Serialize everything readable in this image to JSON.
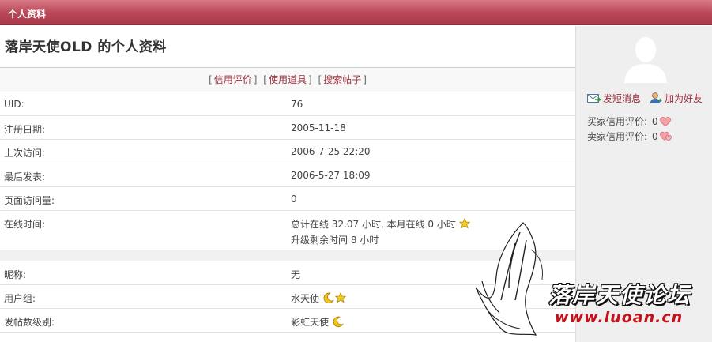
{
  "header": {
    "title": "个人资料"
  },
  "page": {
    "title": "落岸天使OLD 的个人资料"
  },
  "actions": {
    "credit": "信用评价",
    "props": "使用道具",
    "search": "搜索帖子"
  },
  "profile": {
    "uid_label": "UID:",
    "uid_value": "76",
    "reg_label": "注册日期:",
    "reg_value": "2005-11-18",
    "visit_label": "上次访问:",
    "visit_value": "2006-7-25 22:20",
    "post_label": "最后发表:",
    "post_value": "2006-5-27 18:09",
    "views_label": "页面访问量:",
    "views_value": "0",
    "online_label": "在线时间:",
    "online_value": "总计在线  32.07 小时, 本月在线  0 小时",
    "upgrade_value": "升级剩余时间  8 小时",
    "nick_label": "昵称:",
    "nick_value": "无",
    "group_label": "用户组:",
    "group_value": "水天使",
    "level_label": "发帖数级别:",
    "level_value": "彩虹天使"
  },
  "sidebar": {
    "message": "发短消息",
    "add_friend": "加为好友",
    "buyer_label": "买家信用评价:",
    "buyer_value": "0",
    "seller_label": "卖家信用评价:",
    "seller_value": "0"
  },
  "watermark": {
    "name": "落岸天使论坛",
    "url": "www.luoan.cn"
  },
  "colors": {
    "header": "#b84656",
    "link": "#9c2d3a",
    "sidebar_bg": "#efefef"
  },
  "icons": [
    "message-icon",
    "add-friend-icon",
    "star-icon",
    "moon-icon",
    "heart-icon",
    "avatar-placeholder"
  ]
}
